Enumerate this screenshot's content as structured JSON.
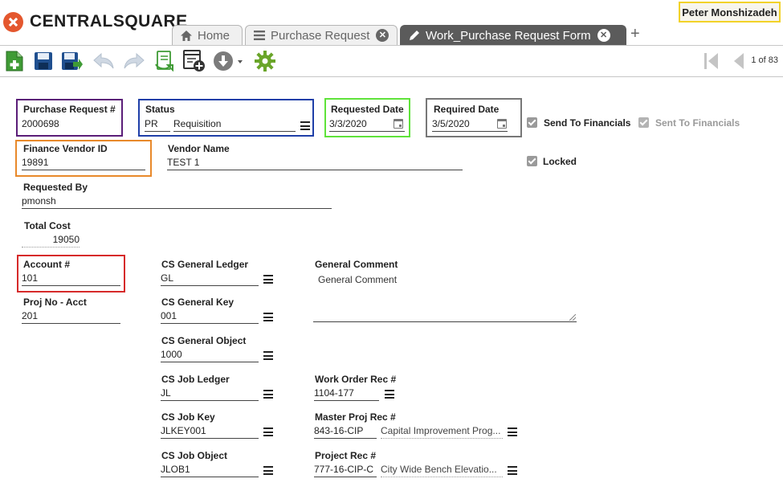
{
  "app": {
    "brand": "CENTRALSQUARE",
    "user": "Peter Monshizadeh"
  },
  "tabs": [
    {
      "label": "Home",
      "icon": "home-icon",
      "closable": false
    },
    {
      "label": "Purchase Request",
      "icon": "list-icon",
      "closable": true
    },
    {
      "label": "Work_Purchase Request Form",
      "icon": "pencil-icon",
      "closable": true,
      "active": true
    }
  ],
  "tab_close_glyph": "✕",
  "tab_add_glyph": "+",
  "toolbar": {
    "pager": "1 of 83"
  },
  "colors": {
    "highlight_purple": "#5b1e78",
    "highlight_blue": "#1f3fa8",
    "highlight_green": "#5fe33a",
    "highlight_gray": "#777777",
    "highlight_orange": "#e8892a",
    "highlight_red": "#d62a2a",
    "user_highlight": "#f2d229"
  },
  "form": {
    "purchase_request": {
      "label": "Purchase Request #",
      "value": "2000698"
    },
    "status": {
      "label": "Status",
      "code": "PR",
      "value": "Requisition"
    },
    "requested_date": {
      "label": "Requested Date",
      "value": "3/3/2020"
    },
    "required_date": {
      "label": "Required Date",
      "value": "3/5/2020"
    },
    "send_to_financials": {
      "label": "Send To Financials",
      "checked": true
    },
    "sent_to_financials": {
      "label": "Sent To Financials",
      "checked": true
    },
    "finance_vendor_id": {
      "label": "Finance Vendor ID",
      "value": "19891"
    },
    "vendor_name": {
      "label": "Vendor Name",
      "value": "TEST 1"
    },
    "locked": {
      "label": "Locked",
      "checked": true
    },
    "requested_by": {
      "label": "Requested By",
      "value": "pmonsh"
    },
    "total_cost": {
      "label": "Total Cost",
      "value": "19050"
    },
    "account": {
      "label": "Account #",
      "value": "101"
    },
    "proj_no_acct": {
      "label": "Proj No - Acct",
      "value": "201"
    },
    "cs_general_ledger": {
      "label": "CS General Ledger",
      "value": "GL"
    },
    "cs_general_key": {
      "label": "CS General Key",
      "value": "001"
    },
    "cs_general_object": {
      "label": "CS General Object",
      "value": "1000"
    },
    "cs_job_ledger": {
      "label": "CS Job Ledger",
      "value": "JL"
    },
    "cs_job_key": {
      "label": "CS Job Key",
      "value": "JLKEY001"
    },
    "cs_job_object": {
      "label": "CS Job Object",
      "value": "JLOB1"
    },
    "general_comment": {
      "label": "General Comment",
      "value": "General Comment"
    },
    "work_order_rec": {
      "label": "Work Order Rec #",
      "value": "1104-177"
    },
    "master_proj_rec": {
      "label": "Master Proj Rec #",
      "value": "843-16-CIP",
      "desc": "Capital Improvement Prog..."
    },
    "project_rec": {
      "label": "Project Rec #",
      "value": "777-16-CIP-C",
      "desc": "City Wide Bench Elevatio..."
    }
  }
}
